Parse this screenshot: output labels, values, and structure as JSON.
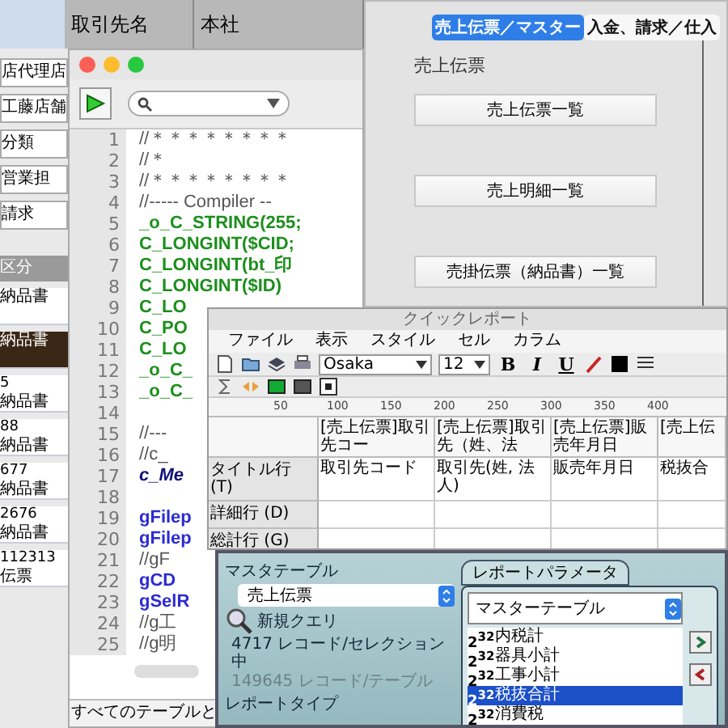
{
  "back_window": {
    "columns": [
      "取引先名",
      "本社"
    ],
    "fields": [
      "店代理店",
      "工藤店舗",
      "分類",
      "営業担",
      "請求"
    ],
    "list_header": "区分",
    "rows": [
      {
        "label": "納品書",
        "selected": false
      },
      {
        "label": "納品書",
        "selected": true
      },
      {
        "code": "5",
        "label": "納品書",
        "selected": false
      },
      {
        "code": "88",
        "label": "納品書",
        "selected": false
      },
      {
        "code": "677",
        "label": "納品書",
        "selected": false
      },
      {
        "code": "2676",
        "label": "納品書",
        "selected": false
      },
      {
        "code": "112313",
        "label": "伝票",
        "selected": false
      }
    ]
  },
  "code_editor": {
    "lines": [
      {
        "number": "1",
        "text": "//＊＊＊＊＊＊＊＊",
        "kind": "comment"
      },
      {
        "number": "2",
        "text": "//＊",
        "kind": "comment"
      },
      {
        "number": "3",
        "text": "//＊＊＊＊＊＊＊＊",
        "kind": "comment"
      },
      {
        "number": "4",
        "text": "//----- Compiler --",
        "kind": "comment"
      },
      {
        "number": "5",
        "text": "_o_C_STRING(255;",
        "kind": "declaration"
      },
      {
        "number": "6",
        "text": "C_LONGINT($CID;",
        "kind": "declaration"
      },
      {
        "number": "7",
        "text": "C_LONGINT(bt_印",
        "kind": "declaration"
      },
      {
        "number": "8",
        "text": "C_LONGINT($ID)",
        "kind": "declaration"
      },
      {
        "number": "9",
        "text": "C_LO",
        "kind": "declaration"
      },
      {
        "number": "10",
        "text": "C_PO",
        "kind": "declaration"
      },
      {
        "number": "11",
        "text": "C_LO",
        "kind": "declaration"
      },
      {
        "number": "12",
        "text": "_o_C_",
        "kind": "declaration"
      },
      {
        "number": "13",
        "text": "_o_C_",
        "kind": "declaration"
      },
      {
        "number": "14"
      },
      {
        "number": "15",
        "text": "//---",
        "kind": "comment"
      },
      {
        "number": "16",
        "text": "//c_",
        "kind": "comment"
      },
      {
        "number": "17",
        "text": "c_Me",
        "kind": "method"
      },
      {
        "number": "18"
      },
      {
        "number": "19",
        "text": "gFilep",
        "kind": "variable"
      },
      {
        "number": "20",
        "text": "gFilep",
        "kind": "variable"
      },
      {
        "number": "21",
        "text": "//gF",
        "kind": "comment"
      },
      {
        "number": "22",
        "text": "gCD",
        "kind": "variable"
      },
      {
        "number": "23",
        "text": "gSelR",
        "kind": "variable"
      },
      {
        "number": "24",
        "text": "//g工",
        "kind": "comment"
      },
      {
        "number": "25",
        "text": "//g明",
        "kind": "comment"
      }
    ],
    "footer": "すべてのテーブルと"
  },
  "sales_window": {
    "tabs": [
      {
        "label": "売上伝票／マスター",
        "selected": true
      },
      {
        "label": "入金、請求／仕入",
        "selected": false
      }
    ],
    "section": "売上伝票",
    "buttons": [
      "売上伝票一覧",
      "売上明細一覧",
      "売掛伝票（納品書）一覧"
    ]
  },
  "quick_report": {
    "title": "クイックレポート",
    "menu": [
      "ファイル",
      "表示",
      "スタイル",
      "セル",
      "カラム"
    ],
    "font": "Osaka",
    "size": "12",
    "style_buttons": [
      "B",
      "I",
      "U"
    ],
    "ruler": [
      "50",
      "100",
      "150",
      "200",
      "250",
      "300",
      "350",
      "400"
    ],
    "columns": [
      "[売上伝票]取引先コー",
      "[売上伝票]取引先（姓、法",
      "[売上伝票]販売年月日",
      "[売上伝"
    ],
    "rows": [
      {
        "label": "タイトル行 (T)",
        "cells": [
          "取引先コード",
          "取引先(姓, 法人)",
          "販売年月日",
          "税抜合"
        ]
      },
      {
        "label": "詳細行 (D)"
      },
      {
        "label": "総計行 (G)"
      }
    ]
  },
  "report_params": {
    "master_label": "マスタテーブル",
    "master_table": "売上伝票",
    "query": "新規クエリ",
    "selection_count": "4717 レコード/セレクション中",
    "table_count": "149645 レコード/テーブル",
    "report_type_label": "レポートタイプ",
    "params_label": "レポートパラメータ",
    "table_select": "マスターテーブル",
    "fields": [
      {
        "type": "2$^{32}$",
        "name": "内税計",
        "selected": false
      },
      {
        "type": "2$^{32}$",
        "name": "器具小計",
        "selected": false
      },
      {
        "type": "2$^{32}$",
        "name": "工事小計",
        "selected": false
      },
      {
        "type": "2$^{32}$",
        "name": "税抜合計",
        "selected": true
      },
      {
        "type": "2$^{32}$",
        "name": "消費税",
        "selected": false
      }
    ]
  }
}
